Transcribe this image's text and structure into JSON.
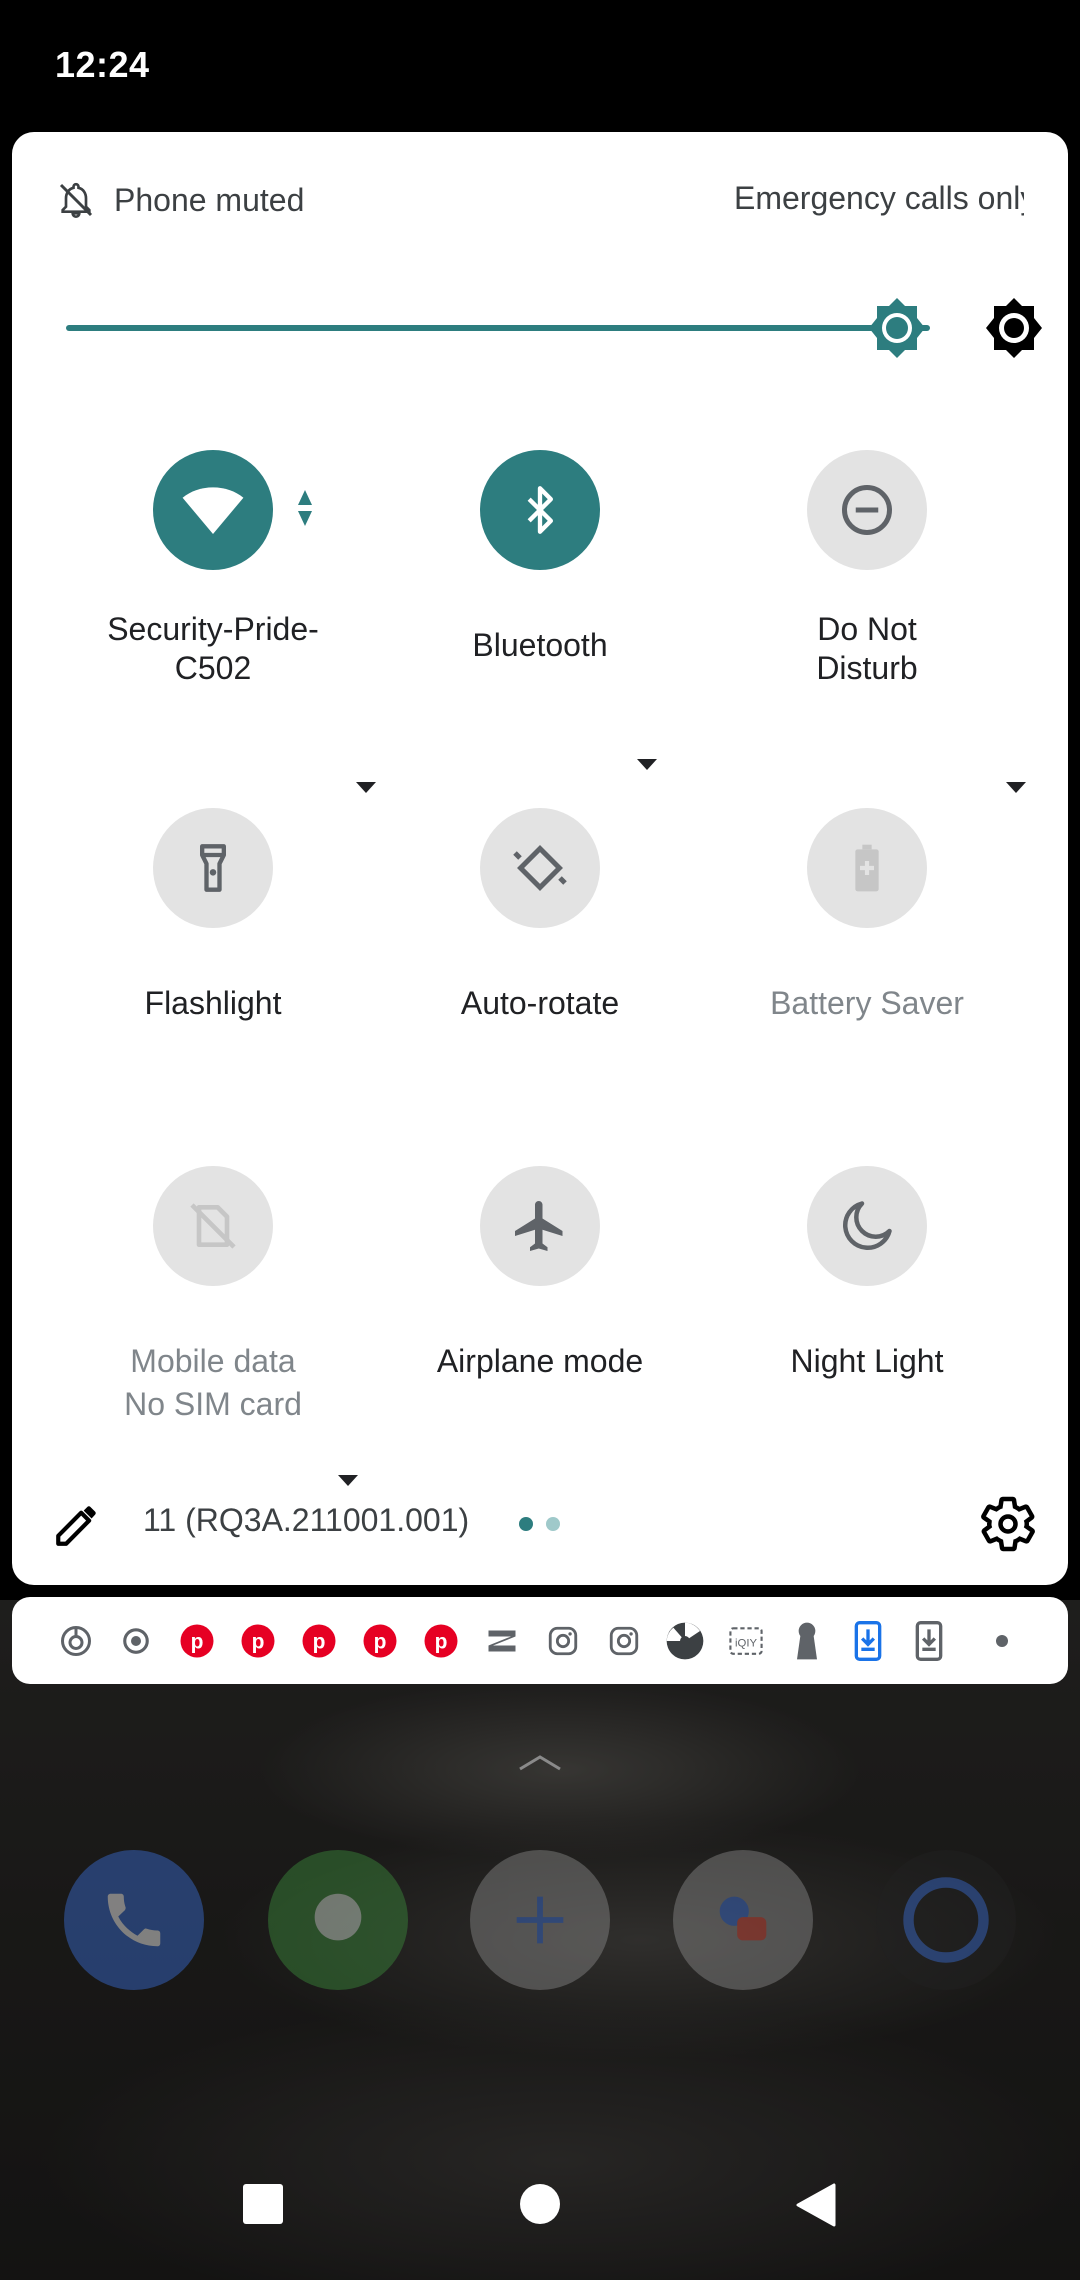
{
  "status_bar": {
    "time": "12:24"
  },
  "quick_settings": {
    "header": {
      "ringer_status": "Phone muted",
      "carrier_status": "Emergency calls only"
    },
    "brightness": {
      "level": 0.93
    },
    "tiles": [
      {
        "label": "Security-Pride-C502",
        "label_line1": "Security-Pride-",
        "label_line2": "C502",
        "state": "on",
        "has_dropdown": true,
        "icon": "wifi-icon"
      },
      {
        "label": "Bluetooth",
        "state": "on",
        "has_dropdown": true,
        "icon": "bluetooth-icon"
      },
      {
        "label": "Do Not Disturb",
        "label_line1": "Do Not",
        "label_line2": "Disturb",
        "state": "off",
        "has_dropdown": true,
        "icon": "do-not-disturb-icon"
      },
      {
        "label": "Flashlight",
        "state": "off",
        "icon": "flashlight-icon"
      },
      {
        "label": "Auto-rotate",
        "state": "off",
        "icon": "auto-rotate-icon"
      },
      {
        "label": "Battery Saver",
        "state": "unavailable",
        "icon": "battery-saver-icon"
      },
      {
        "label": "Mobile data",
        "sublabel": "No SIM card",
        "state": "unavailable",
        "has_dropdown": true,
        "icon": "mobile-data-off-icon"
      },
      {
        "label": "Airplane mode",
        "state": "off",
        "icon": "airplane-icon"
      },
      {
        "label": "Night Light",
        "state": "off",
        "icon": "night-light-icon"
      }
    ],
    "footer": {
      "build_number": "11 (RQ3A.211001.001)",
      "page_count": 2,
      "current_page": 1
    }
  },
  "notification_icons": [
    "pinwheel-icon",
    "record-icon",
    "pinterest-icon",
    "pinterest-icon",
    "pinterest-icon",
    "pinterest-icon",
    "pinterest-icon",
    "capcut-icon",
    "instagram-icon",
    "instagram-icon",
    "aperture-icon",
    "iqiyi-icon",
    "keyhole-icon",
    "download-icon",
    "download-icon",
    "more-dot-icon"
  ],
  "colors": {
    "accent": "#2d7d7f",
    "tile_inactive": "#e3e3e3",
    "pinterest": "#e60023",
    "download_blue": "#1a73e8"
  }
}
